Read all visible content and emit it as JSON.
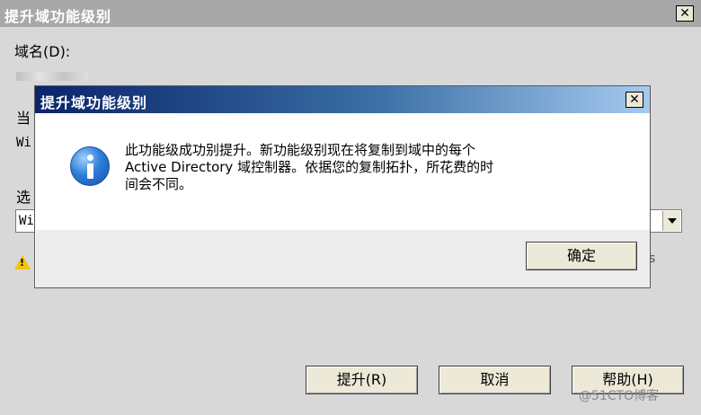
{
  "parent_window": {
    "title": "提升域功能级别",
    "close_symbol": "✕",
    "domain_label": "域名(D):",
    "current_label_partial": "当",
    "current_value_partial": "Wi",
    "select_label_partial": "选",
    "select_value_partial": "Wi",
    "warning_tail": "s",
    "buttons": {
      "upgrade": "提升(R)",
      "cancel": "取消",
      "help": "帮助(H)"
    }
  },
  "dialog": {
    "title": "提升域功能级别",
    "close_symbol": "✕",
    "icon": "info-icon",
    "message_lines": [
      "此功能级成功别提升。新功能级别现在将复制到域中的每个",
      "Active Directory 域控制器。依据您的复制拓扑，所花费的时",
      "间会不同。"
    ],
    "ok_label": "确定"
  },
  "watermark": "@51CTO博客",
  "colors": {
    "dialog_title_start": "#0a246a",
    "dialog_title_end": "#a6caf0",
    "parent_title": "#a8a8a8",
    "warning": "#f3c400"
  }
}
